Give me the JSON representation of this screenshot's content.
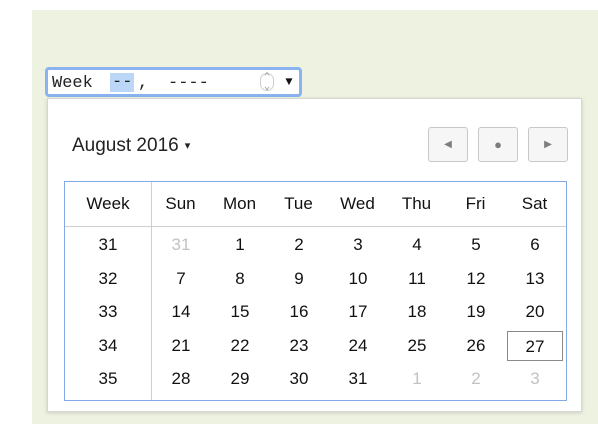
{
  "input": {
    "prefix": "Week",
    "week_value": "--",
    "separator": ",",
    "year_value": "----",
    "spin_icon": "spinner-icon",
    "dropdown_icon": "chevron-down-icon"
  },
  "picker": {
    "month_label": "August 2016",
    "month_caret": "▾",
    "prev_glyph": "◀",
    "today_glyph": "●",
    "next_glyph": "▶",
    "headers": [
      "Week",
      "Sun",
      "Mon",
      "Tue",
      "Wed",
      "Thu",
      "Fri",
      "Sat"
    ],
    "rows": [
      {
        "week": "31",
        "days": [
          "31",
          "1",
          "2",
          "3",
          "4",
          "5",
          "6"
        ]
      },
      {
        "week": "32",
        "days": [
          "7",
          "8",
          "9",
          "10",
          "11",
          "12",
          "13"
        ]
      },
      {
        "week": "33",
        "days": [
          "14",
          "15",
          "16",
          "17",
          "18",
          "19",
          "20"
        ]
      },
      {
        "week": "34",
        "days": [
          "21",
          "22",
          "23",
          "24",
          "25",
          "26",
          "27"
        ]
      },
      {
        "week": "35",
        "days": [
          "28",
          "29",
          "30",
          "31",
          "1",
          "2",
          "3"
        ]
      }
    ],
    "muted_days": [
      [
        0,
        0
      ],
      [
        4,
        4
      ],
      [
        4,
        5
      ],
      [
        4,
        6
      ]
    ],
    "selected_day": [
      3,
      6
    ]
  },
  "colors": {
    "background": "#eef2e1",
    "input_focus_border": "#89b4f0",
    "grid_border": "#82a9ea",
    "muted_text": "#c2c2c2"
  }
}
